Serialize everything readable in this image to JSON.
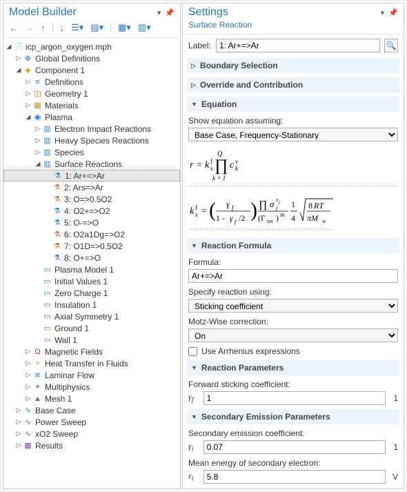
{
  "panels": {
    "left_title": "Model Builder",
    "right_title": "Settings",
    "right_subtitle": "Surface Reaction"
  },
  "label_row": {
    "label": "Label:",
    "value": "1: Ar+=>Ar"
  },
  "sections": {
    "boundary": "Boundary Selection",
    "override": "Override and Contribution",
    "equation": "Equation",
    "reaction_formula": "Reaction Formula",
    "reaction_params": "Reaction Parameters",
    "secondary": "Secondary Emission Parameters"
  },
  "equation": {
    "show_label": "Show equation assuming:",
    "assume": "Base Case, Frequency-Stationary"
  },
  "formula": {
    "label": "Formula:",
    "value": "Ar+=>Ar",
    "specify_label": "Specify reaction using:",
    "specify_value": "Sticking coefficient",
    "motz_label": "Motz-Wise correction:",
    "motz_value": "On",
    "arrhenius_label": "Use Arrhenius expressions"
  },
  "params": {
    "fwd_label": "Forward sticking coefficient:",
    "fwd_sym": "γ",
    "fwd_sub": "f",
    "fwd_value": "1",
    "fwd_unit": "1",
    "sec_label": "Secondary emission coefficient:",
    "sec_sym": "γ",
    "sec_sub": "i",
    "sec_value": "0.07",
    "sec_unit": "1",
    "energy_label": "Mean energy of secondary electron:",
    "energy_sym": "ε",
    "energy_sub": "i",
    "energy_value": "5.8",
    "energy_unit": "V"
  },
  "tree": [
    {
      "d": 0,
      "caret": "down",
      "icon": "📄",
      "c": "#555",
      "label": "icp_argon_oxygen.mph",
      "name": "root-file"
    },
    {
      "d": 1,
      "caret": "right",
      "icon": "⊕",
      "c": "#1e7fd6",
      "label": "Global Definitions",
      "name": "global-defs"
    },
    {
      "d": 1,
      "caret": "down",
      "icon": "◈",
      "c": "#d08a1e",
      "label": "Component 1",
      "name": "component-1"
    },
    {
      "d": 2,
      "caret": "right",
      "icon": "≡",
      "c": "#1e7fd6",
      "label": "Definitions",
      "name": "definitions"
    },
    {
      "d": 2,
      "caret": "right",
      "icon": "◫",
      "c": "#d0661e",
      "label": "Geometry 1",
      "name": "geometry-1"
    },
    {
      "d": 2,
      "caret": "right",
      "icon": "▦",
      "c": "#d08a1e",
      "label": "Materials",
      "name": "materials"
    },
    {
      "d": 2,
      "caret": "down",
      "icon": "◉",
      "c": "#1e7fd6",
      "label": "Plasma",
      "name": "plasma"
    },
    {
      "d": 3,
      "caret": "right",
      "icon": "▥",
      "c": "#1e7fd6",
      "label": "Electron Impact Reactions",
      "name": "electron-impact"
    },
    {
      "d": 3,
      "caret": "right",
      "icon": "▥",
      "c": "#1e7fd6",
      "label": "Heavy Species Reactions",
      "name": "heavy-species"
    },
    {
      "d": 3,
      "caret": "right",
      "icon": "▥",
      "c": "#1e7fd6",
      "label": "Species",
      "name": "species"
    },
    {
      "d": 3,
      "caret": "down",
      "icon": "▥",
      "c": "#1e7fd6",
      "label": "Surface Reactions",
      "name": "surface-reactions"
    },
    {
      "d": 4,
      "caret": "",
      "icon": "⚗",
      "c": "#1e7fd6",
      "label": "1: Ar+=>Ar",
      "name": "reaction-1",
      "selected": true
    },
    {
      "d": 4,
      "caret": "",
      "icon": "⚗",
      "c": "#d0661e",
      "label": "2: Ars=>Ar",
      "name": "reaction-2"
    },
    {
      "d": 4,
      "caret": "",
      "icon": "⚗",
      "c": "#d0661e",
      "label": "3: O=>0.5O2",
      "name": "reaction-3"
    },
    {
      "d": 4,
      "caret": "",
      "icon": "⚗",
      "c": "#1e7fd6",
      "label": "4: O2+=>O2",
      "name": "reaction-4"
    },
    {
      "d": 4,
      "caret": "",
      "icon": "⚗",
      "c": "#1e7fd6",
      "label": "5: O-=>O",
      "name": "reaction-5"
    },
    {
      "d": 4,
      "caret": "",
      "icon": "⚗",
      "c": "#d0661e",
      "label": "6: O2a1Dg=>O2",
      "name": "reaction-6"
    },
    {
      "d": 4,
      "caret": "",
      "icon": "⚗",
      "c": "#d0661e",
      "label": "7: O1D=>0.5O2",
      "name": "reaction-7"
    },
    {
      "d": 4,
      "caret": "",
      "icon": "⚗",
      "c": "#1e7fd6",
      "label": "8: O+=>O",
      "name": "reaction-8"
    },
    {
      "d": 3,
      "caret": "",
      "icon": "▭",
      "c": "#1e7fd6",
      "label": "Plasma Model 1",
      "name": "plasma-model-1"
    },
    {
      "d": 3,
      "caret": "",
      "icon": "▭",
      "c": "#1e7fd6",
      "label": "Initial Values 1",
      "name": "initial-values"
    },
    {
      "d": 3,
      "caret": "",
      "icon": "▭",
      "c": "#1e7fd6",
      "label": "Zero Charge 1",
      "name": "zero-charge"
    },
    {
      "d": 3,
      "caret": "",
      "icon": "▭",
      "c": "#1e7fd6",
      "label": "Insulation 1",
      "name": "insulation"
    },
    {
      "d": 3,
      "caret": "",
      "icon": "▭",
      "c": "#1e7fd6",
      "label": "Axial Symmetry 1",
      "name": "axial-symmetry"
    },
    {
      "d": 3,
      "caret": "",
      "icon": "▭",
      "c": "#d0661e",
      "label": "Ground 1",
      "name": "ground"
    },
    {
      "d": 3,
      "caret": "",
      "icon": "▭",
      "c": "#d0661e",
      "label": "Wall 1",
      "name": "wall"
    },
    {
      "d": 2,
      "caret": "right",
      "icon": "Ω",
      "c": "#c23a3a",
      "label": "Magnetic Fields",
      "name": "magnetic-fields"
    },
    {
      "d": 2,
      "caret": "right",
      "icon": "≈",
      "c": "#d08a1e",
      "label": "Heat Transfer in Fluids",
      "name": "heat-transfer"
    },
    {
      "d": 2,
      "caret": "right",
      "icon": "≋",
      "c": "#1e7fd6",
      "label": "Laminar Flow",
      "name": "laminar-flow"
    },
    {
      "d": 2,
      "caret": "right",
      "icon": "✦",
      "c": "#8a8a8a",
      "label": "Multiphysics",
      "name": "multiphysics"
    },
    {
      "d": 2,
      "caret": "right",
      "icon": "▲",
      "c": "#3a8a3a",
      "label": "Mesh 1",
      "name": "mesh"
    },
    {
      "d": 1,
      "caret": "right",
      "icon": "∿",
      "c": "#1e7fd6",
      "label": "Base Case",
      "name": "base-case"
    },
    {
      "d": 1,
      "caret": "right",
      "icon": "∿",
      "c": "#1e7fd6",
      "label": "Power Sweep",
      "name": "power-sweep"
    },
    {
      "d": 1,
      "caret": "right",
      "icon": "∿",
      "c": "#1e7fd6",
      "label": "xO2 Sweep",
      "name": "xo2-sweep"
    },
    {
      "d": 1,
      "caret": "right",
      "icon": "▦",
      "c": "#7a4aa8",
      "label": "Results",
      "name": "results"
    }
  ]
}
